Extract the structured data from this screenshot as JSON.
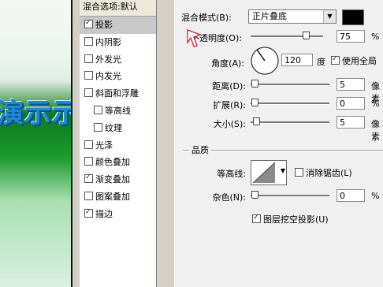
{
  "preview": {
    "text": "演示示画"
  },
  "styles_panel": {
    "header": "混合选项:默认",
    "items": [
      {
        "label": "投影",
        "checked": true,
        "selected": true,
        "sub": false
      },
      {
        "label": "内阴影",
        "checked": false,
        "selected": false,
        "sub": false
      },
      {
        "label": "外发光",
        "checked": false,
        "selected": false,
        "sub": false
      },
      {
        "label": "内发光",
        "checked": false,
        "selected": false,
        "sub": false
      },
      {
        "label": "斜面和浮雕",
        "checked": false,
        "selected": false,
        "sub": false
      },
      {
        "label": "等高线",
        "checked": false,
        "selected": false,
        "sub": true
      },
      {
        "label": "纹理",
        "checked": false,
        "selected": false,
        "sub": true
      },
      {
        "label": "光泽",
        "checked": false,
        "selected": false,
        "sub": false
      },
      {
        "label": "颜色叠加",
        "checked": false,
        "selected": false,
        "sub": false
      },
      {
        "label": "渐变叠加",
        "checked": true,
        "selected": false,
        "sub": false
      },
      {
        "label": "图案叠加",
        "checked": false,
        "selected": false,
        "sub": false
      },
      {
        "label": "描边",
        "checked": true,
        "selected": false,
        "sub": false
      }
    ]
  },
  "structure": {
    "blend_mode_label": "混合模式(B):",
    "blend_mode_value": "正片叠底",
    "shadow_color": "#000000",
    "opacity_label": "不透明度(O):",
    "opacity_value": "75",
    "opacity_unit": "%",
    "angle_label": "角度(A):",
    "angle_value": "120",
    "angle_unit": "度",
    "global_light_label": "使用全局",
    "global_light_checked": true,
    "distance_label": "距离(D):",
    "distance_value": "5",
    "distance_unit": "像素",
    "spread_label": "扩展(R):",
    "spread_value": "0",
    "spread_unit": "%",
    "size_label": "大小(S):",
    "size_value": "5",
    "size_unit": "像素"
  },
  "quality": {
    "section_title": "品质",
    "contour_label": "等高线:",
    "anti_alias_label": "消除锯齿(L)",
    "anti_alias_checked": false,
    "noise_label": "杂色(N):",
    "noise_value": "0",
    "noise_unit": "%",
    "knockout_label": "图层挖空投影(U)",
    "knockout_checked": true
  }
}
